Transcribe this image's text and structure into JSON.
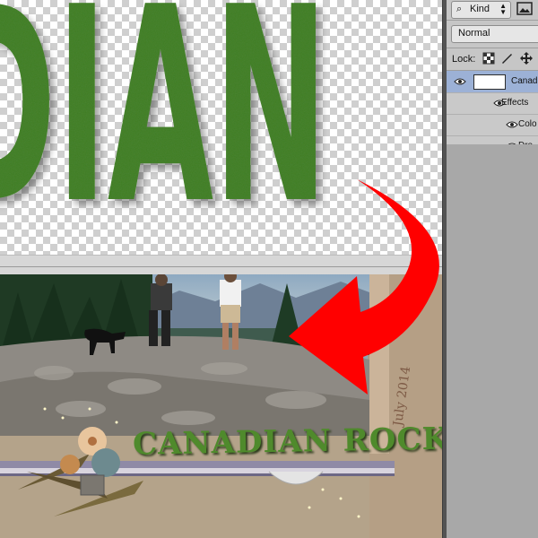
{
  "canvas_top": {
    "text": "DIAN"
  },
  "photo": {
    "title": "CANADIAN ROCKIES",
    "date": "July 2014"
  },
  "layers_panel": {
    "filter": {
      "kind_label": "Kind",
      "icon": "search-icon"
    },
    "blend_mode": "Normal",
    "lock_label": "Lock:",
    "layers": [
      {
        "name": "Canad",
        "type": "text-layer",
        "visible": true,
        "selected": true
      },
      {
        "name": "Effects",
        "type": "effects-group",
        "visible": true
      },
      {
        "name": "Colo",
        "type": "effect",
        "visible": true
      },
      {
        "name": "Dro",
        "type": "effect",
        "visible": true
      }
    ]
  },
  "colors": {
    "accent_arrow": "#ff0000",
    "title_green": "#4f8a2c",
    "selection_blue": "#9cb1d6"
  }
}
